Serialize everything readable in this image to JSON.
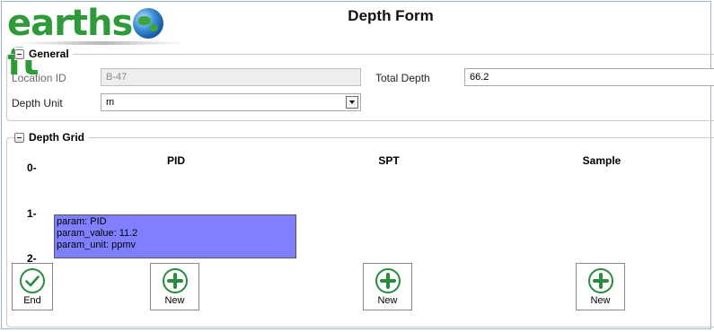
{
  "logo": {
    "text_left": "earths",
    "text_right": "ft"
  },
  "form": {
    "title": "Depth Form"
  },
  "general": {
    "section_title": "General",
    "location_id": {
      "label": "Location ID",
      "value": "B-47"
    },
    "depth_unit": {
      "label": "Depth Unit",
      "value": "m"
    },
    "total_depth": {
      "label": "Total Depth",
      "value": "66.2"
    }
  },
  "depth_grid": {
    "section_title": "Depth Grid",
    "columns": [
      "PID",
      "SPT",
      "Sample"
    ],
    "depth_marks": [
      "0-",
      "1-",
      "2-"
    ],
    "entry": {
      "line1": "param: PID",
      "line2": "param_value: 11.2",
      "line3": "param_unit: ppmv"
    }
  },
  "buttons": {
    "end": "End",
    "new": "New"
  },
  "colors": {
    "logo_green": "#2e9a3a",
    "button_green": "#2a8a3e",
    "entry_fill": "#8080ff"
  },
  "icons": {
    "end": "check-circle-icon",
    "new": "plus-circle-icon",
    "collapse": "minus-box-icon"
  }
}
